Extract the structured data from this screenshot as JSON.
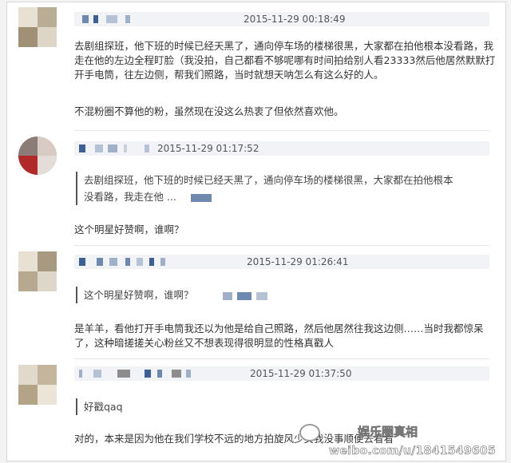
{
  "comments": [
    {
      "time": "2015-11-29 00:18:49",
      "body": "去剧组探班，他下班的时候已经天黑了，通向停车场的楼梯很黑，大家都在拍他根本没看路，我走在他的左边全程盯脸（我没拍，自己都看不够呢哪有时间拍给别人看23333然后他居然默默打开手电筒，往左边侧，帮我们照路，当时就想天呐怎么有这么好的人。",
      "body2": "不混粉圈不算他的粉，虽然现在没这么热衷了但依然喜欢他。"
    },
    {
      "time": "2015-11-29 01:17:52",
      "quote": "去剧组探班，他下班的时候已经天黑了，通向停车场的楼梯很黑，大家都在拍他根本没看路，我走在他 ...",
      "body": "这个明星好赞啊，谁啊？"
    },
    {
      "time": "2015-11-29 01:26:41",
      "quote": "这个明星好赞啊，谁啊？",
      "body": "是羊羊，看他打开手电筒我还以为他是给自己照路，然后他居然往我这边侧……当时我都惊呆了，这种暗搓搓关心粉丝又不想表现得很明显的性格真戳人"
    },
    {
      "time": "2015-11-29 01:37:50",
      "quote": "好戳qaq",
      "body": "对的，本来是因为他在我们学校不远的地方拍旋风少女我没事顺便去看看"
    }
  ],
  "watermark": {
    "logo": "娱乐圈真相",
    "url": "weibo.com/u/1841549605"
  },
  "colors": {
    "blur_blue": "#6f89ae",
    "meta_bg": "#f1f3f6"
  }
}
